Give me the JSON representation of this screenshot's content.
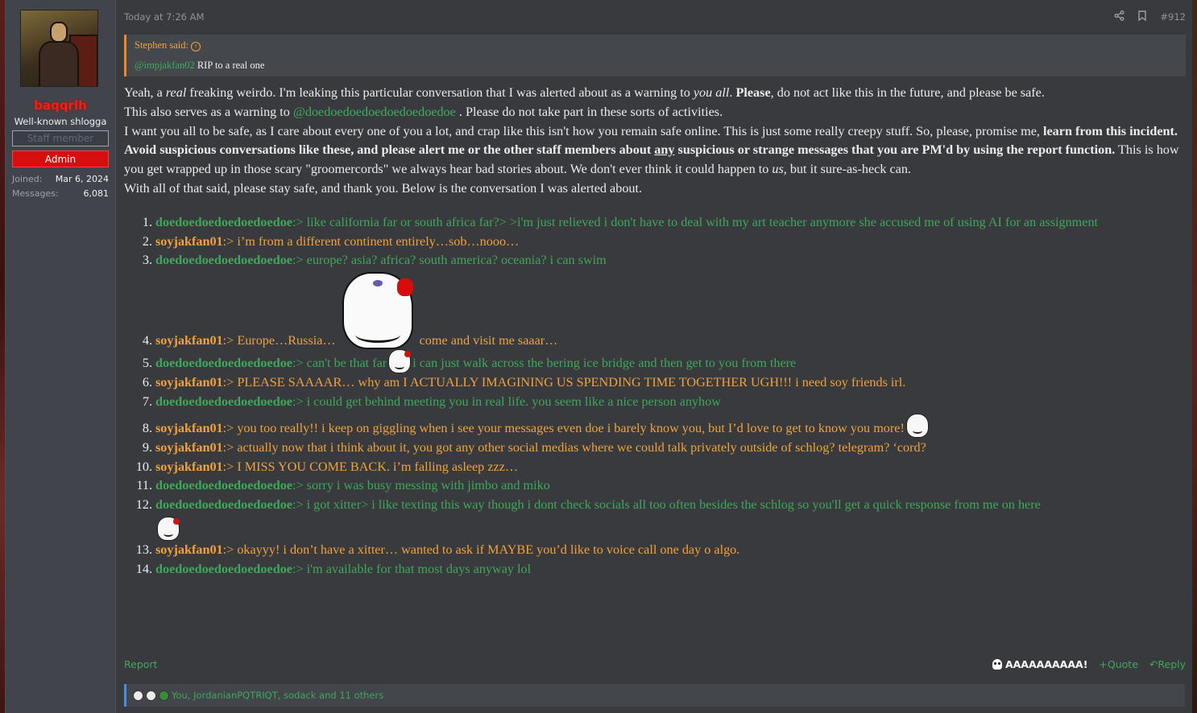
{
  "user": {
    "name": "baqqrlh",
    "title": "Well-known shlogga",
    "banner_staff": "Staff member",
    "banner_admin": "Admin",
    "joined_label": "Joined:",
    "joined_value": "Mar 6, 2024",
    "messages_label": "Messages:",
    "messages_value": "6,081"
  },
  "header": {
    "timestamp": "Today at 7:26 AM",
    "post_number": "#912",
    "icons": [
      "share-icon",
      "bookmark-icon"
    ]
  },
  "quote": {
    "author": "Stephen said:",
    "mention": "@impjakfan02",
    "text": " RIP to a real one"
  },
  "body": {
    "p1a": "Yeah, a ",
    "p1b": "real",
    "p1c": " freaking weirdo. I'm leaking this particular conversation that I was alerted about as a warning to ",
    "p1d": "you all",
    "p1e": ". ",
    "p1f": "Please",
    "p1g": ", do not act like this in the future, and please be safe.",
    "p2a": "This also serves as a warning to ",
    "p2mention": "@doedoedoedoedoedoedoedoe",
    "p2b": " . Please do not take part in these sorts of activities.",
    "p3a": "I want you all to be safe, as I care about every one of you a lot, and crap like this isn't how you remain safe online. This is just some really creepy stuff. So, please, promise me, ",
    "p3b": "learn from this incident. Avoid suspicious conversations like these, and please alert me or the other staff members about ",
    "p3c": "any",
    "p3d": " suspicious or strange messages that you are PM'd by using the report function.",
    "p3e": " This is how you get wrapped up in those scary \"groomercords\" we always hear bad stories about. We don't ever think it could happen to ",
    "p3f": "us",
    "p3g": ", but it sure-as-heck can.",
    "p4": "With all of that said, please stay safe, and thank you. Below is the conversation I was alerted about."
  },
  "conversation": [
    {
      "num": "1.",
      "speaker": "doedoedoedoedoedoedoe",
      "text": ":> like california far or south africa far?> >i'm just relieved i don't have to deal with my art teacher anymore she accused me of using AI for an assignment"
    },
    {
      "num": "2.",
      "speaker": "soyjakfan01",
      "text": ":> i’m from a different continent entirely…sob…nooo…"
    },
    {
      "num": "3.",
      "speaker": "doedoedoedoedoedoedoe",
      "text": ":> europe? asia? africa? south america? oceania? i can swim"
    },
    {
      "num": "4.",
      "speaker": "soyjakfan01",
      "text": ":> Europe…Russia…",
      "text_after": "come and visit me saaar…"
    },
    {
      "num": "5.",
      "speaker": "doedoedoedoedoedoedoe",
      "text": ":> can't be that far",
      "text_after": "i can just walk across the bering ice bridge and then get to you from there"
    },
    {
      "num": "6.",
      "speaker": "soyjakfan01",
      "text": ":> PLEASE SAAAAR… why am I ACTUALLY IMAGINING US SPENDING TIME TOGETHER UGH!!! i need soy friends irl."
    },
    {
      "num": "7.",
      "speaker": "doedoedoedoedoedoedoe",
      "text": ":> i could get behind meeting you in real life. you seem like a nice person anyhow"
    },
    {
      "num": "8.",
      "speaker": "soyjakfan01",
      "text": ":> you too really!! i keep on giggling when i see your messages even doe i barely know you, but I’d love to get to know you more!"
    },
    {
      "num": "9.",
      "speaker": "soyjakfan01",
      "text": ":> actually now that i think about it, you got any other social medias where we could talk privately outside of schlog? telegram? ‘cord?"
    },
    {
      "num": "10.",
      "speaker": "soyjakfan01",
      "text": ":> I MISS YOU COME BACK. i’m falling asleep zzz…"
    },
    {
      "num": "11.",
      "speaker": "doedoedoedoedoedoedoe",
      "text": ":> sorry i was busy messing with jimbo and miko"
    },
    {
      "num": "12.",
      "speaker": "doedoedoedoedoedoedoe",
      "text": ":> i got xitter> i like texting this way though i dont check socials all too often besides the schlog so you'll get a quick response from me on here"
    },
    {
      "num": "13.",
      "speaker": "soyjakfan01",
      "text": ":> okayyy! i don’t have a xitter… wanted to ask if MAYBE you’d like to voice call one day o algo."
    },
    {
      "num": "14.",
      "speaker": "doedoedoedoedoedoedoe",
      "text": ":> i'm available for that most days anyway lol"
    }
  ],
  "footer": {
    "report": "Report",
    "reaction_label": "AAAAAAAAAA!",
    "quote": "+Quote",
    "reply": "Reply"
  },
  "reactions": {
    "text": "You, JordanianPQTRIQT, sodack and 11 others"
  },
  "colors": {
    "green": "#3ea85a",
    "orange": "#f2a23c",
    "admin_red": "#d60e0e",
    "username_red": "#e8231a"
  }
}
